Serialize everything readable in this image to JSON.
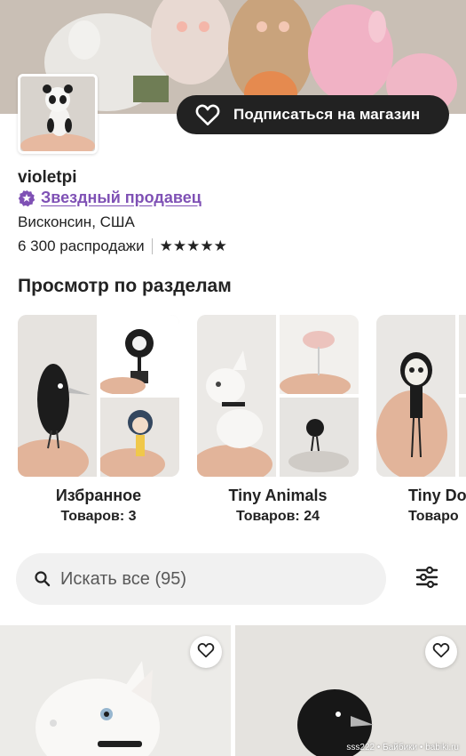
{
  "shop": {
    "follow_label": "Подписаться на магазин",
    "name": "violetpi",
    "star_seller_label": "Звездный продавец",
    "location": "Висконсин, США",
    "sales": "6 300 распродажи",
    "rating_stars": "★★★★★"
  },
  "sections": {
    "title": "Просмотр по разделам",
    "items": [
      {
        "title": "Избранное",
        "count": "Товаров: 3"
      },
      {
        "title": "Tiny Animals",
        "count": "Товаров: 24"
      },
      {
        "title": "Tiny Do",
        "count": "Товаро"
      }
    ]
  },
  "search": {
    "placeholder": "Искать все (95)"
  },
  "watermark": "sss222 • Байбики • babiki.ru",
  "colors": {
    "star_seller": "#7f51b5",
    "button_dark": "#222222",
    "search_bg": "#f1f1f1"
  },
  "icons": [
    "heart-icon",
    "star-seller-badge-icon",
    "search-icon",
    "filter-sliders-icon"
  ]
}
